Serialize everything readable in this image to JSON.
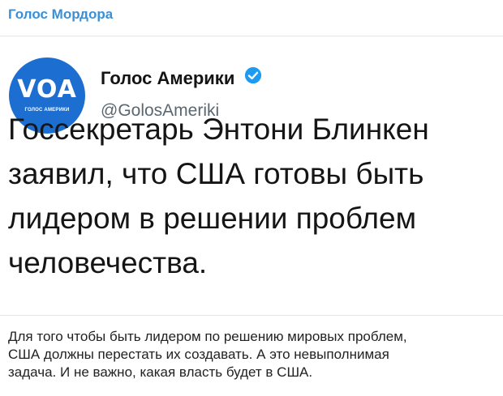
{
  "channel": {
    "name": "Голос Мордора"
  },
  "embed": {
    "avatar": {
      "logo_text": "VOA",
      "logo_subtext": "ГОЛОС АМЕРИКИ",
      "color": "#1c6fd0"
    },
    "account_name": "Голос Америки",
    "verified_icon": "verified-badge-icon",
    "handle": "@GolosAmeriki",
    "lines": [
      "Госсекретарь Энтони Блинкен",
      "заявил, что США готовы быть",
      "лидером в решении проблем",
      "человечества."
    ]
  },
  "caption": {
    "lines": [
      "Для того чтобы быть лидером по решению мировых проблем,",
      "США должны перестать их создавать. А это невыполнимая",
      "задача. И не важно, какая власть будет в США."
    ]
  },
  "colors": {
    "channel_link": "#3a8fd6",
    "verified": "#1d9bf0"
  }
}
